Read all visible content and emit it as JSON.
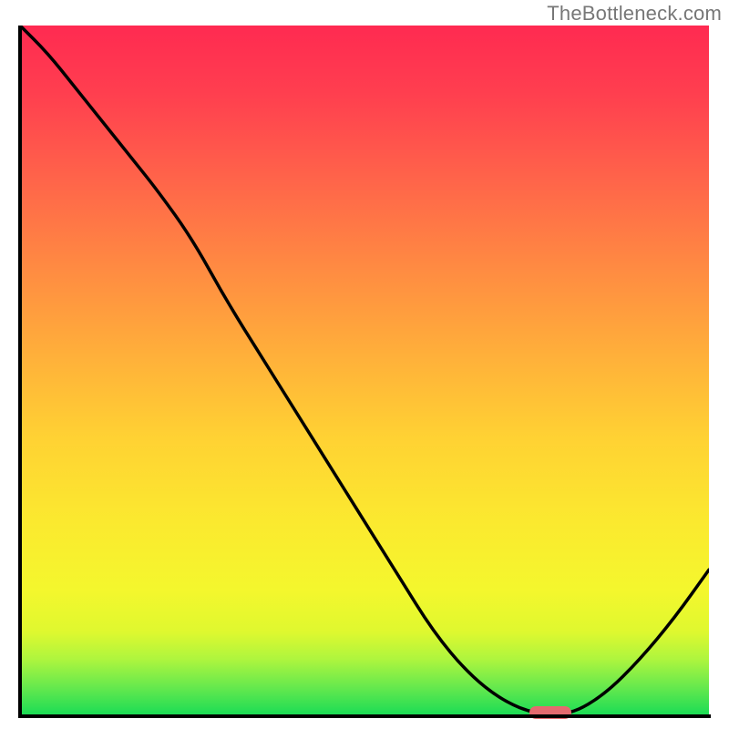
{
  "watermark": "TheBottleneck.com",
  "colors": {
    "gradient_top": "#ff2a51",
    "gradient_bottom": "#1cdc55",
    "curve": "#000000",
    "marker": "#e46a6f",
    "axis": "#000000"
  },
  "chart_data": {
    "type": "line",
    "title": "",
    "xlabel": "",
    "ylabel": "",
    "xlim": [
      0,
      100
    ],
    "ylim": [
      0,
      100
    ],
    "grid": false,
    "legend": false,
    "x": [
      0,
      4,
      8,
      12,
      16,
      20,
      25,
      30,
      35,
      40,
      45,
      50,
      55,
      60,
      65,
      70,
      75,
      80,
      85,
      90,
      95,
      100
    ],
    "values": [
      100,
      96,
      91,
      86,
      81,
      76,
      69,
      60,
      52,
      44,
      36,
      28,
      20,
      12,
      6,
      2,
      0,
      0,
      3,
      8,
      14,
      21
    ],
    "marker": {
      "x": 77,
      "width": 6,
      "y": 0
    },
    "background": "red-yellow-green vertical gradient"
  }
}
